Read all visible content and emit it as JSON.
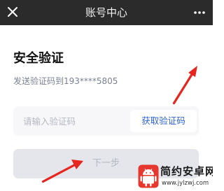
{
  "nav": {
    "title": "账号中心",
    "close_icon": "close-icon",
    "more_icon": "more-icon"
  },
  "main": {
    "heading": "安全验证",
    "subtitle": "发送验证码到193****5805",
    "code_input": {
      "placeholder": "请输入验证码",
      "value": ""
    },
    "get_code_label": "获取验证码",
    "next_label": "下一步"
  },
  "watermark": {
    "name": "简约安卓网",
    "url": "www.jylzwj.com"
  },
  "colors": {
    "topbar": "#2b2b2b",
    "link": "#2e63d1",
    "annotation_arrow": "#e6251e",
    "disabled_button": "#e4e6eb"
  }
}
